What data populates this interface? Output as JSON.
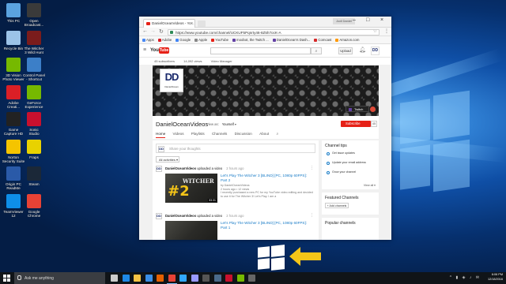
{
  "desktop": {
    "icons": [
      {
        "label": "This PC",
        "color": "#5ba3e0"
      },
      {
        "label": "Open\nBroadcast...",
        "color": "#3a3a3a"
      },
      {
        "label": "Recycle Bin",
        "color": "#9cc3e8"
      },
      {
        "label": "The Witcher\n3 Wild Hunt",
        "color": "#7a1c1c"
      },
      {
        "label": "3D Vision\nPhoto Viewer",
        "color": "#76b900"
      },
      {
        "label": "Control Panel\n- Shortcut",
        "color": "#3c7fc8"
      },
      {
        "label": "Adobe\nCreati...",
        "color": "#da1f26"
      },
      {
        "label": "GeForce\nExperience",
        "color": "#76b900"
      },
      {
        "label": "Game\nCapture HD",
        "color": "#222222"
      },
      {
        "label": "Sonic\nStudio",
        "color": "#c8102e"
      },
      {
        "label": "Norton\nSecurity Suite",
        "color": "#f5c400"
      },
      {
        "label": "Fraps",
        "color": "#e8d200"
      },
      {
        "label": "Origin PC\nReadMe",
        "color": "#2a5aa8"
      },
      {
        "label": "Steam",
        "color": "#1b2838"
      },
      {
        "label": "TeamViewer\n12",
        "color": "#0e8ee9"
      },
      {
        "label": "Google\nChrome",
        "color": "#e84235"
      }
    ]
  },
  "browser": {
    "tab_title": "DanielOceanVideos - Yo...",
    "profile": "Jodi Daniel",
    "url": "https://www.youtube.com/channel/UCKUF5Pqnrty46-8Z5h7ocK-A",
    "bookmarks": [
      {
        "label": "Apps",
        "color": "#4a8af4"
      },
      {
        "label": "Adobe",
        "color": "#da1f26"
      },
      {
        "label": "Google",
        "color": "#4285f4"
      },
      {
        "label": "Apple",
        "color": "#888888"
      },
      {
        "label": "YouTube",
        "color": "#e62117"
      },
      {
        "label": "moobot, the Twitch ...",
        "color": "#6441a5"
      },
      {
        "label": "DanielOcean's Dash...",
        "color": "#6441a5"
      },
      {
        "label": "Comcast",
        "color": "#d62828"
      },
      {
        "label": "Amazon.com",
        "color": "#ff9900"
      }
    ]
  },
  "youtube": {
    "logo_you": "You",
    "logo_tube": "Tube",
    "upload_label": "Upload",
    "avatar": "DD",
    "stats": [
      "45 subscribers",
      "14,092 views",
      "Video Manager"
    ],
    "banner_logo": "DD",
    "banner_logo_name": "DanielOcean",
    "twitch_label": "Twitch",
    "channel_name": "DanielOceanVideos",
    "view_as_label": "View as:",
    "view_as_value": "Yourself",
    "subscribe_label": "Subscribe",
    "subscribe_count": "45",
    "tabs": [
      "Home",
      "Videos",
      "Playlists",
      "Channels",
      "Discussion",
      "About"
    ],
    "share_placeholder": "Share your thoughts",
    "all_activities": "All activities",
    "feed": [
      {
        "avatar": "DD",
        "author": "DanielOceanVideos",
        "action": "uploaded a video",
        "time": "2 hours ago",
        "thumb_number": "#2",
        "thumb_title": "WITCHER",
        "duration": "53:31",
        "title": "Let's Play The Witcher 3 [BLIND] [PC, 1080p 60FPS]: Part 2",
        "by": "by DanielOceanVideos",
        "meta": "2 hours ago • 12 views",
        "desc": "I recently purchased a new PC for my YouTube video editing and decided to use it for The Witcher 3! Let's Play. I am a"
      },
      {
        "avatar": "DD",
        "author": "DanielOceanVideos",
        "action": "uploaded a video",
        "time": "2 hours ago",
        "thumb_number": "",
        "thumb_title": "",
        "duration": "",
        "title": "Let's Play The Witcher 3 [BLIND] [PC, 1080p 60FPS]: Part 1",
        "by": "",
        "meta": "",
        "desc": ""
      }
    ],
    "channel_tips": {
      "title": "Channel tips",
      "items": [
        "Get issue updates",
        "Update your email address",
        "Grow your channel"
      ],
      "view_all": "View all"
    },
    "featured": {
      "title": "Featured Channels",
      "add_label": "+ Add channels"
    },
    "popular": {
      "title": "Popular channels"
    }
  },
  "taskbar": {
    "search_placeholder": "Ask me anything",
    "apps": [
      {
        "name": "task-view",
        "color": "#cccccc"
      },
      {
        "name": "edge",
        "color": "#1e88e5"
      },
      {
        "name": "file-explorer",
        "color": "#f6c344"
      },
      {
        "name": "store",
        "color": "#3a8ee6"
      },
      {
        "name": "firefox",
        "color": "#e66000"
      },
      {
        "name": "chrome",
        "color": "#e84235"
      },
      {
        "name": "photoshop",
        "color": "#31a8ff"
      },
      {
        "name": "premiere",
        "color": "#9999ff"
      },
      {
        "name": "obs",
        "color": "#555555"
      },
      {
        "name": "steam",
        "color": "#4a6a8a"
      },
      {
        "name": "app",
        "color": "#c8102e"
      },
      {
        "name": "app",
        "color": "#76b900"
      },
      {
        "name": "app",
        "color": "#666666"
      }
    ],
    "time": "6:06 PM",
    "date": "12/18/2016"
  },
  "colors": {
    "youtube_red": "#e62117",
    "link_blue": "#167ac6",
    "hint_arrow": "#f5c518"
  }
}
